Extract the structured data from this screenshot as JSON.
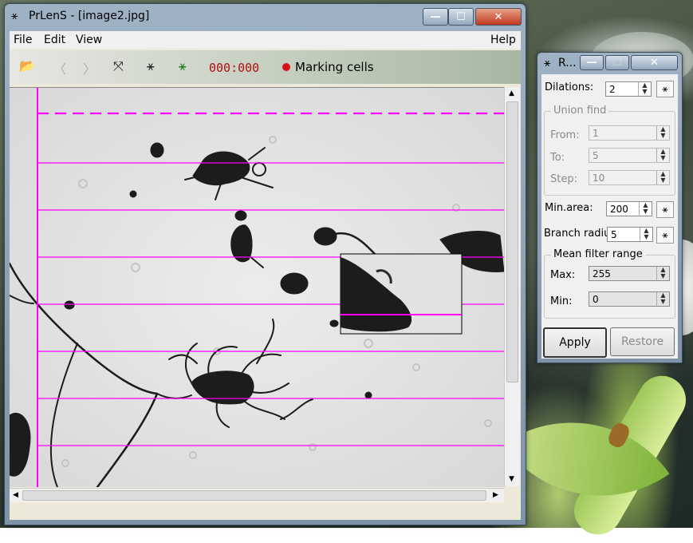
{
  "main_window": {
    "title": "PrLenS - [image2.jpg]",
    "minimize": "—",
    "maximize": "☐",
    "close": "✕",
    "menu": [
      "File",
      "Edit",
      "View"
    ],
    "help": "Help",
    "counter": "000:000",
    "status_text": "Marking cells",
    "status_color": "#d41414",
    "line_color": "#ff00ff"
  },
  "dialog": {
    "title": "R...",
    "dilations_label": "Dilations:",
    "dilations_value": "2",
    "union_find_label": "Union find",
    "from_label": "From:",
    "from_value": "1",
    "to_label": "To:",
    "to_value": "5",
    "step_label": "Step:",
    "step_value": "10",
    "min_area_label": "Min.area:",
    "min_area_value": "200",
    "branch_label": "Branch radiu",
    "branch_value": "5",
    "mean_filter_label": "Mean filter range",
    "max_label": "Max:",
    "max_value": "255",
    "min_label": "Min:",
    "min_value": "0",
    "apply_label": "Apply",
    "restore_label": "Restore"
  }
}
